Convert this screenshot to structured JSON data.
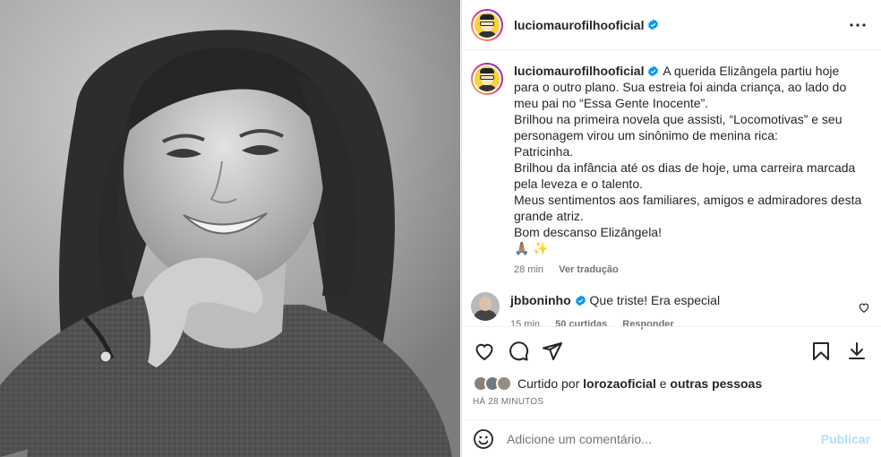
{
  "post": {
    "username": "luciomaurofilhooficial",
    "caption_lines": [
      "A querida Elizângela partiu hoje para o outro plano. Sua estreia foi ainda criança, ao lado do meu pai no “Essa Gente Inocente”.",
      "Brilhou na primeira novela que assisti, “Locomotivas” e seu personagem virou um sinônimo de menina rica:",
      "Patricinha.",
      "Brilhou da infância até os dias de hoje, uma carreira marcada pela leveza e o talento.",
      "Meus sentimentos aos familiares, amigos e admiradores desta grande atriz.",
      "Bom descanso Elizângela!",
      "🙏🏽 ✨"
    ],
    "caption_time": "28 min",
    "translate_label": "Ver tradução"
  },
  "comment": {
    "username": "jbboninho",
    "text": "Que triste! Era especial",
    "time": "15 min",
    "likes": "50 curtidas",
    "reply_label": "Responder"
  },
  "likes": {
    "prefix": "Curtido por",
    "user": "lorozaoficial",
    "joiner": "e",
    "others": "outras pessoas"
  },
  "timestamp": "HÁ 28 MINUTOS",
  "comment_box": {
    "placeholder": "Adicione um comentário...",
    "publish_label": "Publicar"
  },
  "colors": {
    "verified": "#0095f6",
    "publish_disabled": "#b2dffc",
    "avatar_ring": [
      "#f9ce34",
      "#ee2a7b",
      "#6228d7"
    ]
  }
}
